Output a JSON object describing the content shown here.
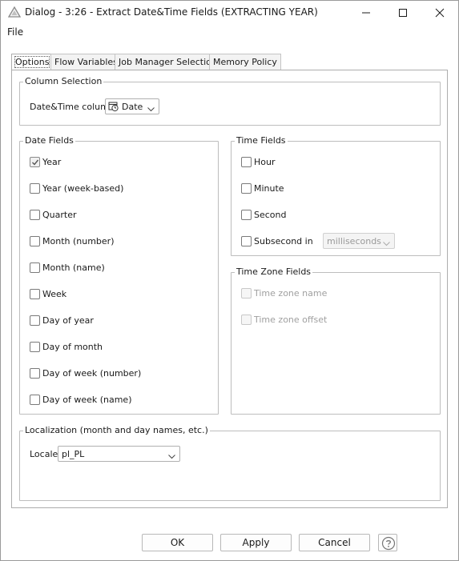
{
  "window": {
    "title": "Dialog - 3:26 - Extract Date&Time Fields (EXTRACTING YEAR)"
  },
  "menu": {
    "file": "File"
  },
  "tabs": [
    {
      "label": "Options",
      "active": true
    },
    {
      "label": "Flow Variables",
      "active": false
    },
    {
      "label": "Job Manager Selection",
      "active": false
    },
    {
      "label": "Memory Policy",
      "active": false
    }
  ],
  "column_selection": {
    "legend": "Column Selection",
    "label": "Date&Time column",
    "value": "Date"
  },
  "date_fields": {
    "legend": "Date Fields",
    "items": [
      {
        "label": "Year",
        "checked": true
      },
      {
        "label": "Year (week-based)",
        "checked": false
      },
      {
        "label": "Quarter",
        "checked": false
      },
      {
        "label": "Month (number)",
        "checked": false
      },
      {
        "label": "Month (name)",
        "checked": false
      },
      {
        "label": "Week",
        "checked": false
      },
      {
        "label": "Day of year",
        "checked": false
      },
      {
        "label": "Day of month",
        "checked": false
      },
      {
        "label": "Day of week (number)",
        "checked": false
      },
      {
        "label": "Day of week (name)",
        "checked": false
      }
    ]
  },
  "time_fields": {
    "legend": "Time Fields",
    "items": [
      {
        "label": "Hour",
        "checked": false
      },
      {
        "label": "Minute",
        "checked": false
      },
      {
        "label": "Second",
        "checked": false
      },
      {
        "label": "Subsecond in",
        "checked": false
      }
    ],
    "subsecond_unit": "milliseconds"
  },
  "time_zone_fields": {
    "legend": "Time Zone Fields",
    "items": [
      {
        "label": "Time zone name",
        "checked": false,
        "disabled": true
      },
      {
        "label": "Time zone offset",
        "checked": false,
        "disabled": true
      }
    ]
  },
  "localization": {
    "legend": "Localization (month and day names, etc.)",
    "label": "Locale",
    "value": "pl_PL"
  },
  "buttons": {
    "ok": "OK",
    "apply": "Apply",
    "cancel": "Cancel"
  },
  "icons": {
    "app": "knime-triangle-icon",
    "column_type": "clock-calendar-icon",
    "help": "question-icon"
  }
}
